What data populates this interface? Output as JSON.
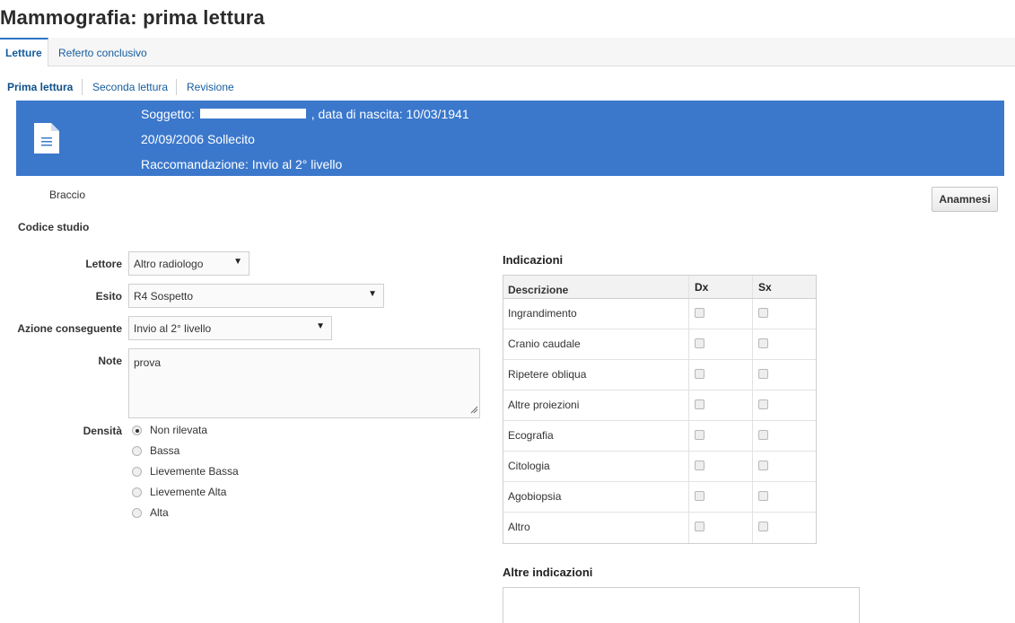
{
  "page": {
    "title": "Mammografia: prima lettura"
  },
  "tabs": [
    {
      "label": "Letture",
      "active": true
    },
    {
      "label": "Referto conclusivo",
      "active": false
    }
  ],
  "subtabs": [
    {
      "label": "Prima lettura",
      "active": true
    },
    {
      "label": "Seconda lettura",
      "active": false
    },
    {
      "label": "Revisione",
      "active": false
    }
  ],
  "banner": {
    "icon": "document-icon",
    "subject_prefix": "Soggetto:",
    "subject_suffix": ", data di nascita: 10/03/1941",
    "line2": "20/09/2006 Sollecito",
    "line3": "Raccomandazione: Invio al 2° livello",
    "background": "#3b78cc"
  },
  "labels": {
    "braccio": "Braccio",
    "codice_studio": "Codice studio",
    "lettore": "Lettore",
    "esito": "Esito",
    "azione": "Azione conseguente",
    "note": "Note",
    "densita": "Densità"
  },
  "buttons": {
    "anamnesi": "Anamnesi"
  },
  "form": {
    "lettore": "Altro radiologo",
    "esito": "R4 Sospetto",
    "azione": "Invio al 2° livello",
    "note": "prova",
    "densita_options": [
      {
        "label": "Non rilevata",
        "checked": true
      },
      {
        "label": "Bassa",
        "checked": false
      },
      {
        "label": "Lievemente Bassa",
        "checked": false
      },
      {
        "label": "Lievemente Alta",
        "checked": false
      },
      {
        "label": "Alta",
        "checked": false
      }
    ]
  },
  "indicazioni": {
    "title": "Indicazioni",
    "headers": {
      "descrizione": "Descrizione",
      "dx": "Dx",
      "sx": "Sx"
    },
    "rows": [
      {
        "label": "Ingrandimento",
        "dx": false,
        "sx": false
      },
      {
        "label": "Cranio caudale",
        "dx": false,
        "sx": false
      },
      {
        "label": "Ripetere obliqua",
        "dx": false,
        "sx": false
      },
      {
        "label": "Altre proiezioni",
        "dx": false,
        "sx": false
      },
      {
        "label": "Ecografia",
        "dx": false,
        "sx": false
      },
      {
        "label": "Citologia",
        "dx": false,
        "sx": false
      },
      {
        "label": "Agobiopsia",
        "dx": false,
        "sx": false
      },
      {
        "label": "Altro",
        "dx": false,
        "sx": false
      }
    ]
  },
  "altre_indicazioni": {
    "title": "Altre indicazioni",
    "value": ""
  }
}
